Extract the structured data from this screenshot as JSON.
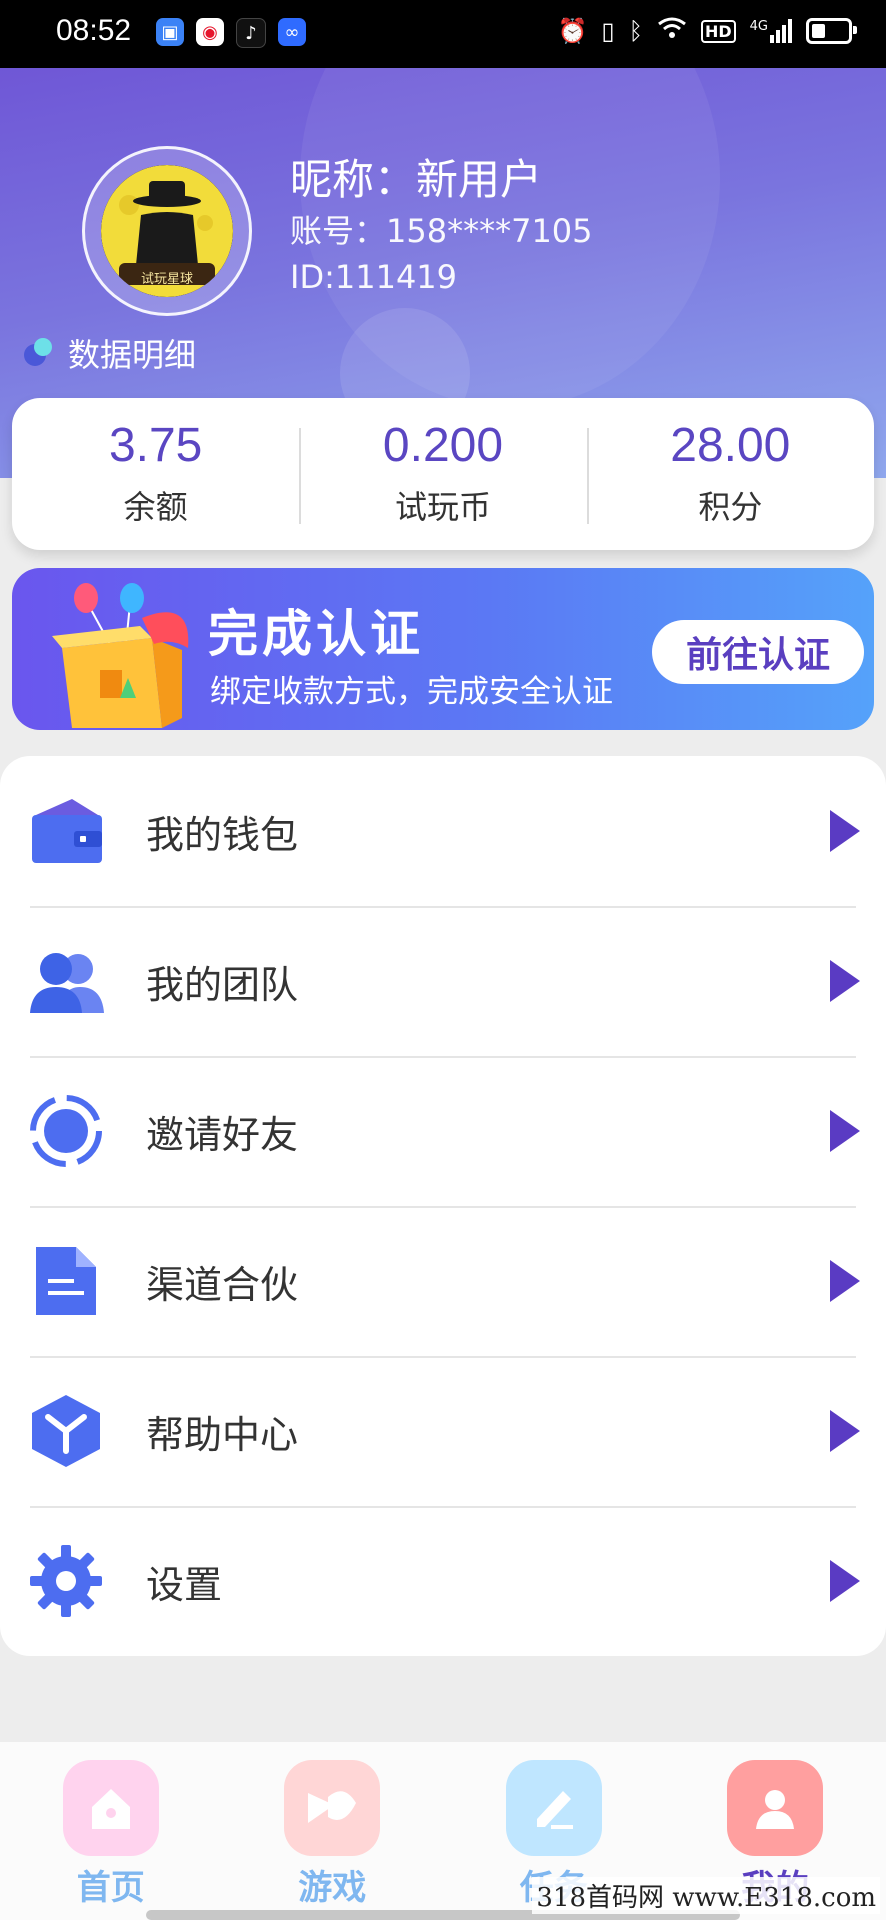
{
  "status_bar": {
    "time": "08:52",
    "network": "4G",
    "hd_badge": "HD",
    "apps": [
      {
        "icon": "square-app-icon",
        "color": "#3b82f6"
      },
      {
        "icon": "weibo-icon",
        "color": "#e6162d"
      },
      {
        "icon": "tiktok-icon",
        "color": "#111111"
      },
      {
        "icon": "infinity-app-icon",
        "color": "#2f6bff"
      }
    ]
  },
  "profile": {
    "name": "昵称：新用户",
    "account": "账号：158****7105",
    "id": "ID:111419",
    "avatar_caption": "试玩星球",
    "data_detail": "数据明细"
  },
  "stats": [
    {
      "value": "3.75",
      "label": "余额"
    },
    {
      "value": "0.200",
      "label": "试玩币"
    },
    {
      "value": "28.00",
      "label": "积分"
    }
  ],
  "banner": {
    "title": "完成认证",
    "subtitle": "绑定收款方式，完成安全认证",
    "button": "前往认证"
  },
  "menu": [
    {
      "label": "我的钱包",
      "icon": "wallet-icon"
    },
    {
      "label": "我的团队",
      "icon": "team-icon"
    },
    {
      "label": "邀请好友",
      "icon": "invite-icon"
    },
    {
      "label": "渠道合伙",
      "icon": "document-icon"
    },
    {
      "label": "帮助中心",
      "icon": "help-icon"
    },
    {
      "label": "设置",
      "icon": "settings-icon"
    }
  ],
  "nav": [
    {
      "label": "首页",
      "icon": "home-icon",
      "color": "#7fb7f0",
      "bg": "#ffd3ee"
    },
    {
      "label": "游戏",
      "icon": "game-icon",
      "color": "#7fb7f0",
      "bg": "#ffd6d6"
    },
    {
      "label": "任务",
      "icon": "task-icon",
      "color": "#7fb7f0",
      "bg": "#bfe6ff"
    },
    {
      "label": "我的",
      "icon": "profile-icon",
      "color": "#5a3fc0",
      "bg": "#ff9f9f"
    }
  ],
  "watermark": "318首码网 www.E318.com",
  "colors": {
    "accent": "#5a46c2",
    "header_start": "#6f57d6",
    "header_end": "#90a8ee"
  }
}
